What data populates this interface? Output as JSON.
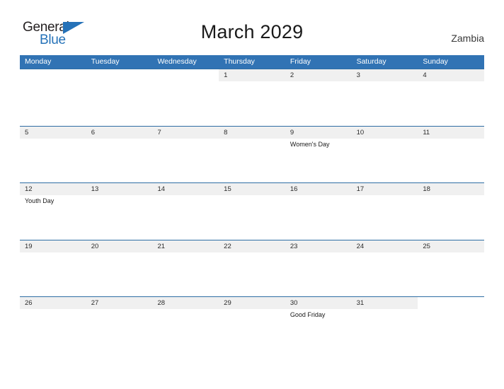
{
  "brand": {
    "name_part1": "General",
    "name_part2": "Blue",
    "flag_icon": "triangle-flag-icon",
    "color_primary": "#2572b8",
    "color_text": "#231f20"
  },
  "header": {
    "title": "March 2029",
    "country": "Zambia"
  },
  "colors": {
    "header_blue": "#3173b4",
    "row_divider_blue": "#2e6da4",
    "day_band_gray": "#f0f0f0",
    "page_background": "#ffffff"
  },
  "calendar": {
    "month": "March",
    "year": "2029",
    "weekday_headers": [
      "Monday",
      "Tuesday",
      "Wednesday",
      "Thursday",
      "Friday",
      "Saturday",
      "Sunday"
    ],
    "weeks": [
      [
        {
          "day": "",
          "event": ""
        },
        {
          "day": "",
          "event": ""
        },
        {
          "day": "",
          "event": ""
        },
        {
          "day": "1",
          "event": ""
        },
        {
          "day": "2",
          "event": ""
        },
        {
          "day": "3",
          "event": ""
        },
        {
          "day": "4",
          "event": ""
        }
      ],
      [
        {
          "day": "5",
          "event": ""
        },
        {
          "day": "6",
          "event": ""
        },
        {
          "day": "7",
          "event": ""
        },
        {
          "day": "8",
          "event": ""
        },
        {
          "day": "9",
          "event": "Women's Day"
        },
        {
          "day": "10",
          "event": ""
        },
        {
          "day": "11",
          "event": ""
        }
      ],
      [
        {
          "day": "12",
          "event": "Youth Day"
        },
        {
          "day": "13",
          "event": ""
        },
        {
          "day": "14",
          "event": ""
        },
        {
          "day": "15",
          "event": ""
        },
        {
          "day": "16",
          "event": ""
        },
        {
          "day": "17",
          "event": ""
        },
        {
          "day": "18",
          "event": ""
        }
      ],
      [
        {
          "day": "19",
          "event": ""
        },
        {
          "day": "20",
          "event": ""
        },
        {
          "day": "21",
          "event": ""
        },
        {
          "day": "22",
          "event": ""
        },
        {
          "day": "23",
          "event": ""
        },
        {
          "day": "24",
          "event": ""
        },
        {
          "day": "25",
          "event": ""
        }
      ],
      [
        {
          "day": "26",
          "event": ""
        },
        {
          "day": "27",
          "event": ""
        },
        {
          "day": "28",
          "event": ""
        },
        {
          "day": "29",
          "event": ""
        },
        {
          "day": "30",
          "event": "Good Friday"
        },
        {
          "day": "31",
          "event": ""
        },
        {
          "day": "",
          "event": ""
        }
      ]
    ]
  }
}
